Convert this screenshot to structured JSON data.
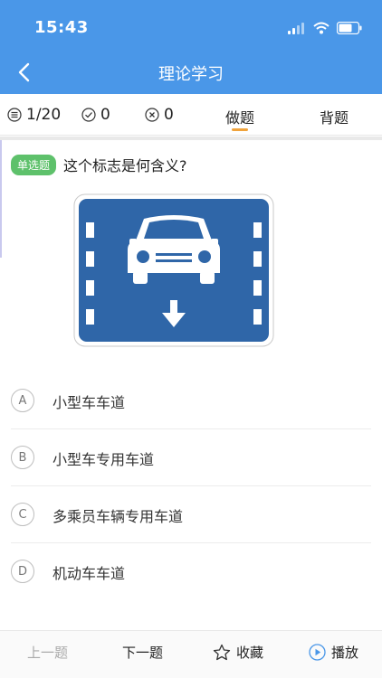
{
  "status_bar": {
    "time": "15:43"
  },
  "nav": {
    "title": "理论学习"
  },
  "stats": {
    "total": "1/20",
    "correct": "0",
    "wrong": "0"
  },
  "tabs": [
    {
      "label": "做题",
      "active": true
    },
    {
      "label": "背题",
      "active": false
    }
  ],
  "question": {
    "type_label": "单选题",
    "text": "这个标志是何含义?"
  },
  "options": [
    {
      "letter": "A",
      "text": "小型车车道"
    },
    {
      "letter": "B",
      "text": "小型车专用车道"
    },
    {
      "letter": "C",
      "text": "多乘员车辆专用车道"
    },
    {
      "letter": "D",
      "text": "机动车车道"
    }
  ],
  "bottom_bar": {
    "prev_label": "上一题",
    "next_label": "下一题",
    "favorite_label": "收藏",
    "play_label": "播放"
  },
  "colors": {
    "header_blue": "#4a97e8",
    "sign_blue": "#2f66a8",
    "badge_green": "#5ec16b",
    "tab_accent": "#f0a33c"
  }
}
